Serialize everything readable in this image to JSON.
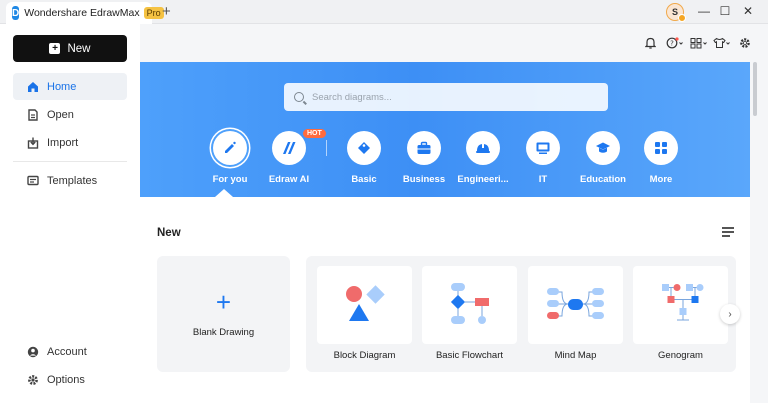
{
  "titlebar": {
    "app_name": "Wondershare EdrawMax",
    "badge": "Pro",
    "new_tab": "+",
    "avatar_initial": "S",
    "minimize": "—",
    "maximize": "☐",
    "close": "✕"
  },
  "sidebar": {
    "new_label": "New",
    "items": [
      {
        "label": "Home",
        "icon": "home-icon"
      },
      {
        "label": "Open",
        "icon": "file-icon"
      },
      {
        "label": "Import",
        "icon": "import-icon"
      },
      {
        "label": "Templates",
        "icon": "templates-icon"
      },
      {
        "label": "Account",
        "icon": "account-icon"
      },
      {
        "label": "Options",
        "icon": "gear-icon"
      }
    ]
  },
  "search": {
    "placeholder": "Search diagrams..."
  },
  "categories": [
    {
      "label": "For you",
      "glyph": "✎"
    },
    {
      "label": "Edraw AI",
      "glyph": "//"
    },
    {
      "label": "Basic",
      "glyph": "◆"
    },
    {
      "label": "Business",
      "glyph": "▣"
    },
    {
      "label": "Engineeri...",
      "glyph": "⛑"
    },
    {
      "label": "IT",
      "glyph": "▭"
    },
    {
      "label": "Education",
      "glyph": "🎓"
    },
    {
      "label": "More",
      "glyph": "▦"
    }
  ],
  "hot_badge": "HOT",
  "new_section": {
    "title": "New",
    "blank_plus": "+",
    "blank_label": "Blank Drawing",
    "templates": [
      "Block Diagram",
      "Basic Flowchart",
      "Mind Map",
      "Genogram"
    ],
    "next": "›"
  },
  "colors": {
    "accent": "#1e78f0",
    "hero_start": "#4ea0fb",
    "hot": "#ff6b3d",
    "shape_red": "#f06b6b",
    "shape_blue": "#1e78f0",
    "shape_light_blue": "#a9cdfb"
  }
}
